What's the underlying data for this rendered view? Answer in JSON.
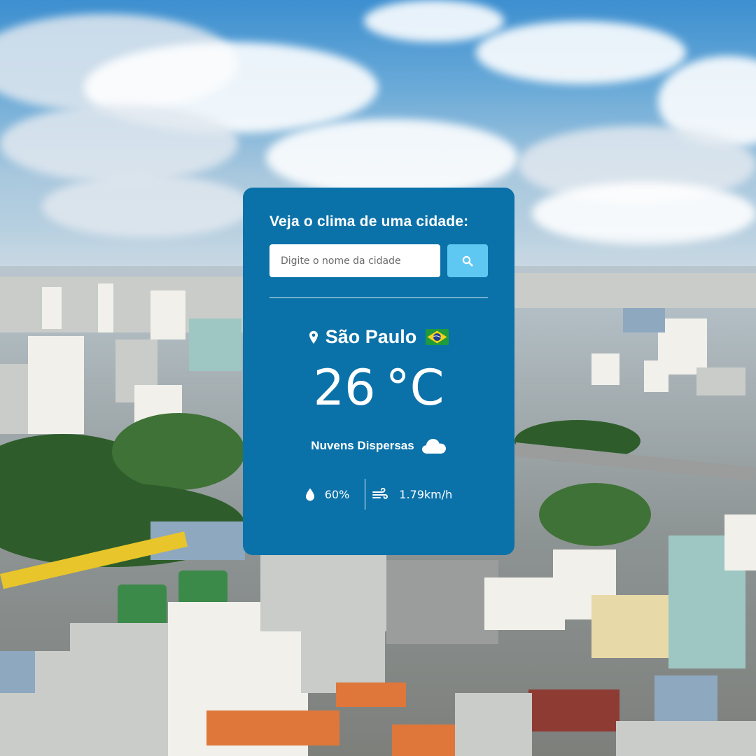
{
  "background": {
    "description_icon": "city-skyline-photo"
  },
  "search": {
    "title": "Veja o clima de uma cidade:",
    "placeholder": "Digite o nome da cidade",
    "value": "",
    "button_icon": "search-icon"
  },
  "weather": {
    "city": "São Paulo",
    "city_icon": "location-pin-icon",
    "country_flag_icon": "brazil-flag-icon",
    "temperature": "26",
    "unit": "°C",
    "description": "Nuvens Dispersas",
    "description_icon": "cloud-icon",
    "humidity": "60%",
    "humidity_icon": "water-drop-icon",
    "wind": "1.79km/h",
    "wind_icon": "wind-icon"
  },
  "colors": {
    "card_bg": "#0b72a9",
    "button_bg": "#5ec8f2",
    "text": "#ffffff"
  }
}
